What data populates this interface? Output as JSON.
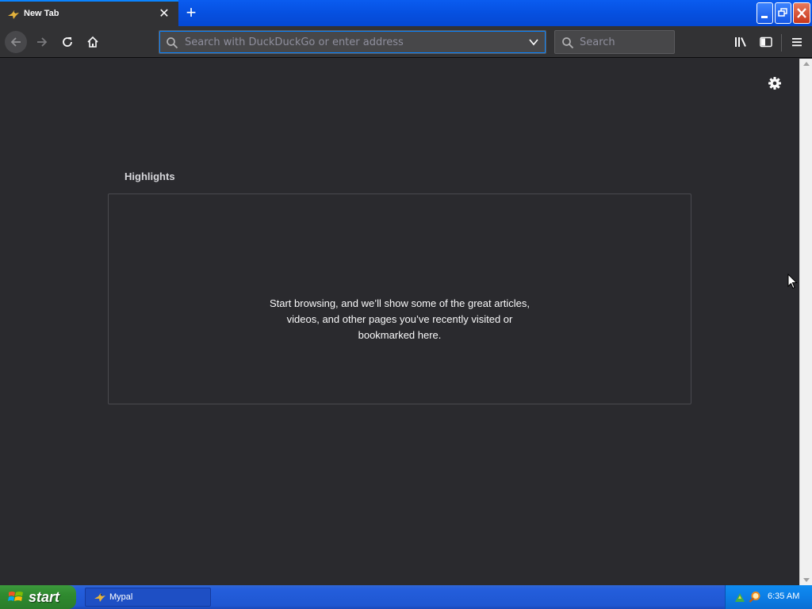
{
  "tab": {
    "title": "New Tab",
    "close_icon": "close-icon"
  },
  "window_controls": {
    "minimize": "minimize-icon",
    "maximize": "restore-icon",
    "close": "close-icon"
  },
  "toolbar": {
    "url_placeholder": "Search with DuckDuckGo or enter address",
    "search_placeholder": "Search"
  },
  "newtab_page": {
    "section_title": "Highlights",
    "empty_message_lines": [
      "Start browsing, and we’ll show some of the great articles,",
      "videos, and other pages you’ve recently visited or",
      "bookmarked here."
    ]
  },
  "taskbar": {
    "start_label": "start",
    "items": [
      {
        "label": "Mypal"
      }
    ],
    "clock": "6:35 AM"
  },
  "colors": {
    "accent": "#0a84ff",
    "background": "#2a2a2e",
    "toolbar": "#323234",
    "text": "#f9f9fa"
  }
}
